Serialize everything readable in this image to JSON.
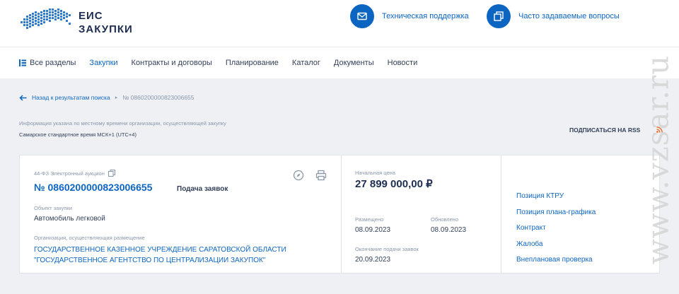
{
  "header": {
    "logo_line1": "ЕИС",
    "logo_line2": "ЗАКУПКИ",
    "support_label": "Техническая поддержка",
    "faq_label": "Часто задаваемые вопросы"
  },
  "nav": {
    "all_sections": "Все разделы",
    "items": [
      "Закупки",
      "Контракты и договоры",
      "Планирование",
      "Каталог",
      "Документы",
      "Новости"
    ],
    "active_index": 0
  },
  "breadcrumb": {
    "back_label": "Назад к результатам поиска",
    "separator": "▸",
    "current": "№ 0860200000823006655"
  },
  "info": {
    "note": "Информация указана по местному времени организации, осуществляющей закупку",
    "timezone": "Самарское стандартное время МСК+1 (UTC+4)",
    "rss_label": "ПОДПИСАТЬСЯ НА RSS"
  },
  "purchase": {
    "law_type": "44-ФЗ Электронный аукцион",
    "number": "№ 0860200000823006655",
    "stage": "Подача заявок",
    "object_label": "Объект закупки",
    "object_value": "Автомобиль легковой",
    "org_label": "Организация, осуществляющая размещение",
    "org_line1": "ГОСУДАРСТВЕННОЕ КАЗЕННОЕ УЧРЕЖДЕНИЕ САРАТОВСКОЙ ОБЛАСТИ",
    "org_line2": "\"ГОСУДАРСТВЕННОЕ АГЕНТСТВО ПО ЦЕНТРАЛИЗАЦИИ ЗАКУПОК\""
  },
  "dates": {
    "price_label": "Начальная цена",
    "price_value": "27 899 000,00 ₽",
    "posted_label": "Размещено",
    "posted_value": "08.09.2023",
    "updated_label": "Обновлено",
    "updated_value": "08.09.2023",
    "deadline_label": "Окончание подачи заявок",
    "deadline_value": "20.09.2023"
  },
  "links": [
    "Позиция КТРУ",
    "Позиция плана-графика",
    "Контракт",
    "Жалоба",
    "Внеплановая проверка"
  ],
  "watermark": "www.vzsar.ru",
  "colors": {
    "accent": "#0d65c2",
    "text": "#334059",
    "muted": "#8a97ab",
    "background": "#eef0f3",
    "rss": "#e8641b"
  }
}
